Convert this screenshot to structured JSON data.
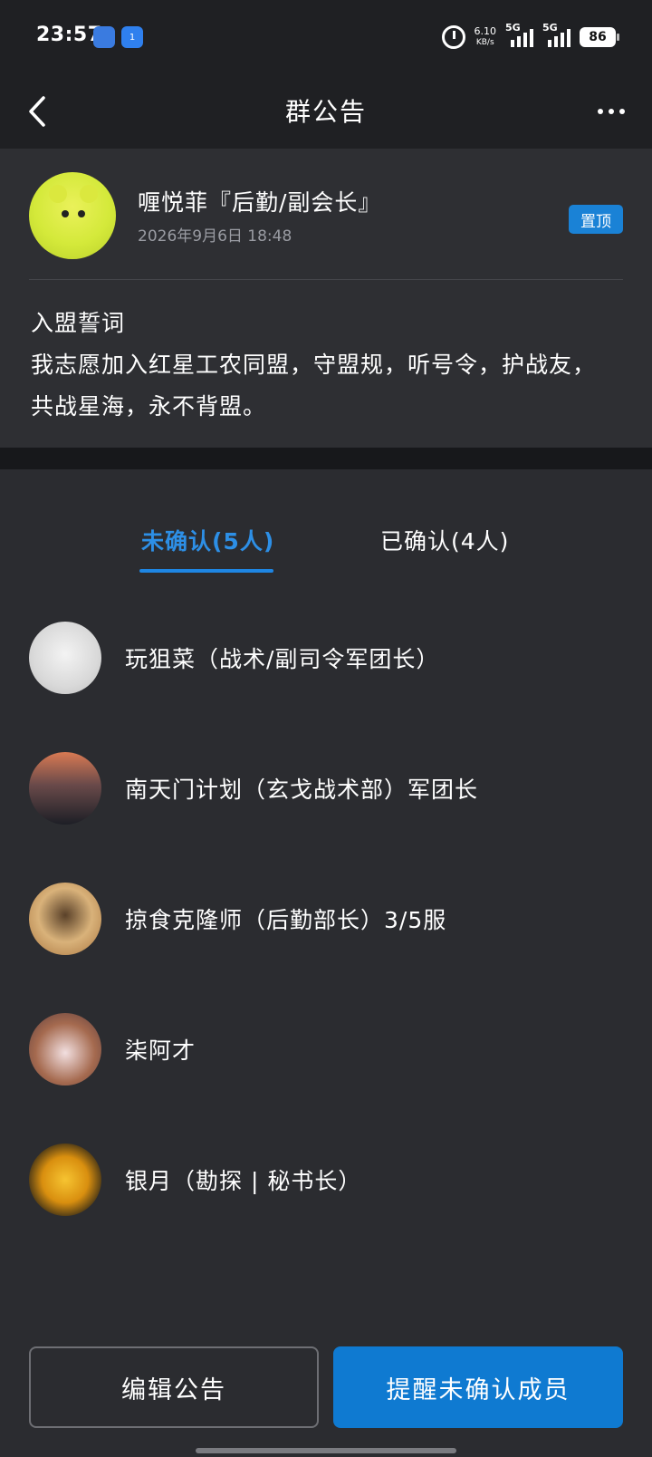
{
  "status_bar": {
    "time": "23:57",
    "badge1": "",
    "badge2": "1",
    "net_speed": "6.10",
    "net_unit": "KB/s",
    "sim1": "5G",
    "sim2": "5G",
    "battery": "86"
  },
  "header": {
    "title": "群公告"
  },
  "announcement": {
    "author": "喱悦菲『后勤/副会长』",
    "time": "2026年9月6日 18:48",
    "pin_label": "置顶",
    "line1": "入盟誓词",
    "line2": "我志愿加入红星工农同盟，守盟规，听号令，护战友，共战星海，永不背盟。"
  },
  "tabs": {
    "unconfirmed": "未确认(5人)",
    "confirmed": "已确认(4人)"
  },
  "members": [
    {
      "name": "玩狙菜（战术/副司令军团长）"
    },
    {
      "name": "南天门计划（玄戈战术部）军团长"
    },
    {
      "name": "掠食克隆师（后勤部长）3/5服"
    },
    {
      "name": "柒阿才"
    },
    {
      "name": "银月（勘探 | 秘书长）"
    }
  ],
  "buttons": {
    "edit": "编辑公告",
    "remind": "提醒未确认成员"
  },
  "colors": {
    "accent": "#1a82d6",
    "tab_active": "#2d8fe6",
    "background": "#2b2c30",
    "header_bg": "#1f2023"
  }
}
